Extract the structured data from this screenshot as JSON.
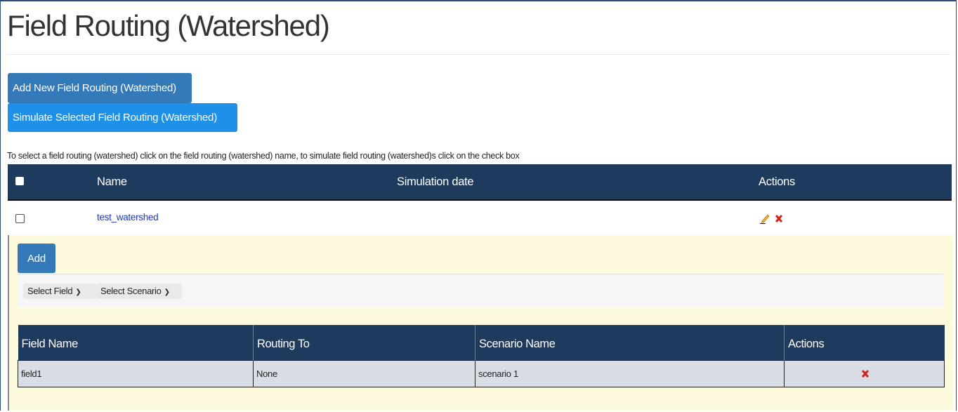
{
  "page": {
    "title": "Field Routing (Watershed)"
  },
  "toolbar": {
    "add_new_label": "Add New Field Routing (Watershed)",
    "simulate_label": "Simulate Selected Field Routing (Watershed)"
  },
  "instructions": "To select a field routing (watershed) click on the field routing (watershed) name, to simulate field routing (watershed)s click on the check box",
  "main_table": {
    "columns": [
      "Name",
      "Simulation date",
      "Actions"
    ],
    "rows": [
      {
        "name": "test_watershed",
        "simulation_date": "",
        "checked": false
      }
    ]
  },
  "sub_panel": {
    "add_label": "Add",
    "select_field": "Select Field",
    "select_scenario": "Select Scenario",
    "table": {
      "columns": [
        "Field Name",
        "Routing To",
        "Scenario Name",
        "Actions"
      ],
      "rows": [
        {
          "field_name": "field1",
          "routing_to": "None",
          "scenario_name": "scenario 1"
        }
      ]
    }
  },
  "icons": {
    "edit": "pencil-icon",
    "delete": "delete-x-icon",
    "dropdown": "chevron-down-icon"
  },
  "colors": {
    "header_bg": "#1e3a5c",
    "primary_button": "#357ab8",
    "simulate_button": "#1e90e8",
    "link": "#1a37c9",
    "panel_bg": "#fdfadd",
    "delete_red": "#d0241c"
  }
}
